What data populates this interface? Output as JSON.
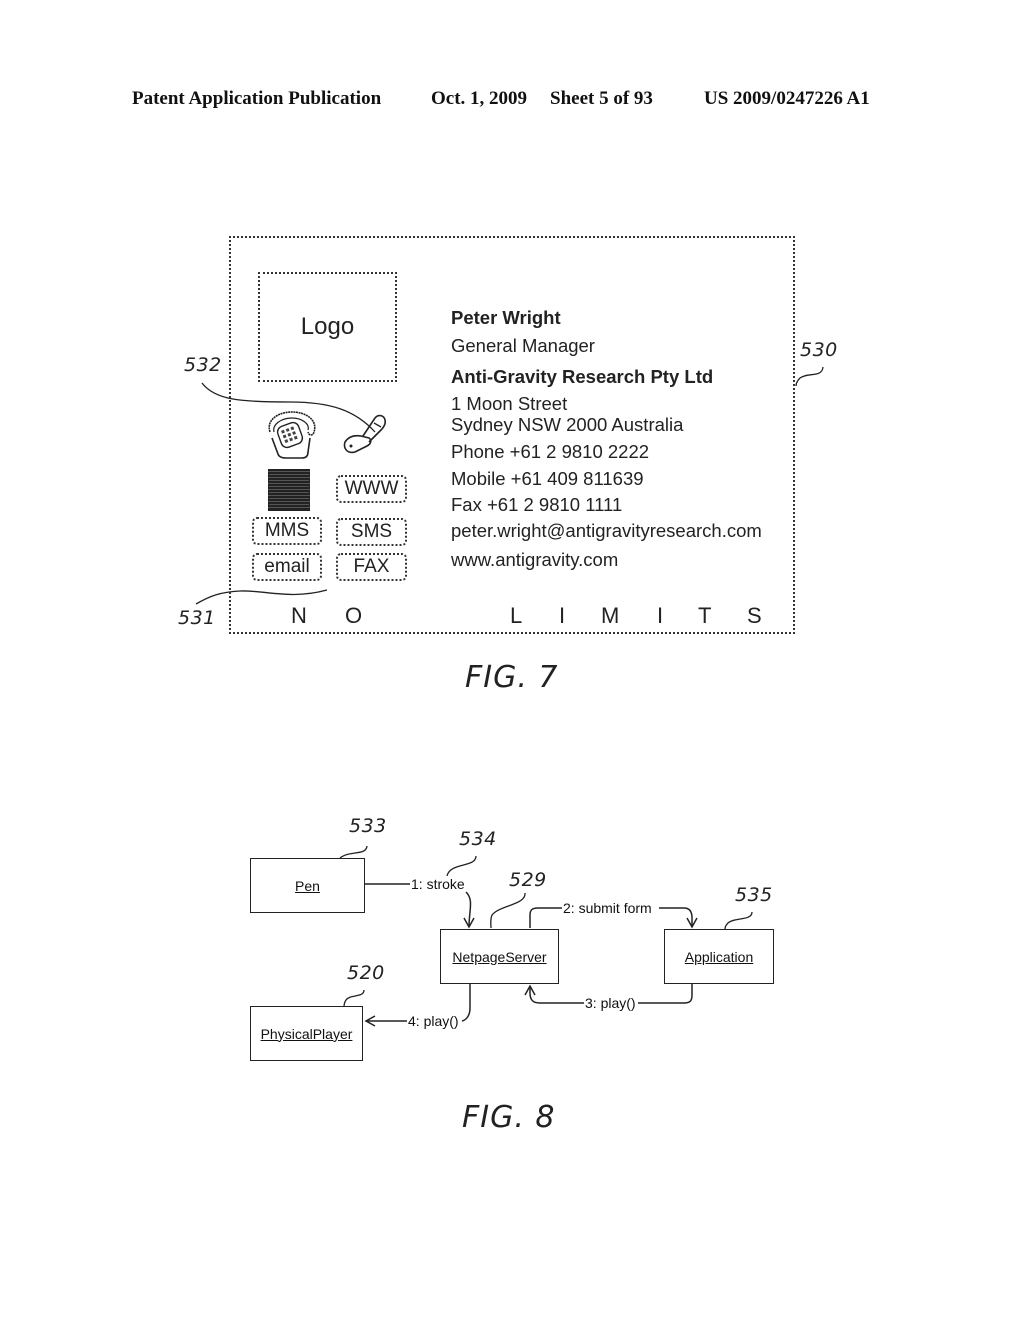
{
  "header": {
    "publication": "Patent Application Publication",
    "date": "Oct. 1, 2009",
    "sheet": "Sheet 5 of 93",
    "number": "US 2009/0247226 A1"
  },
  "fig7": {
    "caption": "FIG. 7",
    "refs": {
      "card": "530",
      "icons": "532",
      "buttons": "531"
    },
    "logo_label": "Logo",
    "contact": {
      "name": "Peter Wright",
      "title": "General Manager",
      "company": "Anti-Gravity Research Pty Ltd",
      "address_line1": "1 Moon Street",
      "address_line2": "Sydney NSW 2000 Australia",
      "phone": "Phone +61 2 9810 2222",
      "mobile": "Mobile +61 409 811639",
      "fax": "Fax +61 2 9810 1111",
      "email": "peter.wright@antigravityresearch.com",
      "website": "www.antigravity.com"
    },
    "icons": [
      "desk-phone-icon",
      "mobile-phone-icon",
      "barcode-icon"
    ],
    "buttons": {
      "www": "WWW",
      "mms": "MMS",
      "sms": "SMS",
      "email": "email",
      "fax": "FAX"
    },
    "tagline": [
      "N",
      "O",
      "L",
      "I",
      "M",
      "I",
      "T",
      "S"
    ]
  },
  "fig8": {
    "caption": "FIG. 8",
    "refs": {
      "pen": "533",
      "stroke": "534",
      "server": "529",
      "application": "535",
      "player": "520"
    },
    "objects": {
      "pen": "Pen",
      "server": "NetpageServer",
      "application": "Application",
      "player": "PhysicalPlayer"
    },
    "messages": {
      "m1": "1: stroke",
      "m2": "2: submit form",
      "m3": "3: play()",
      "m4": "4: play()"
    }
  }
}
